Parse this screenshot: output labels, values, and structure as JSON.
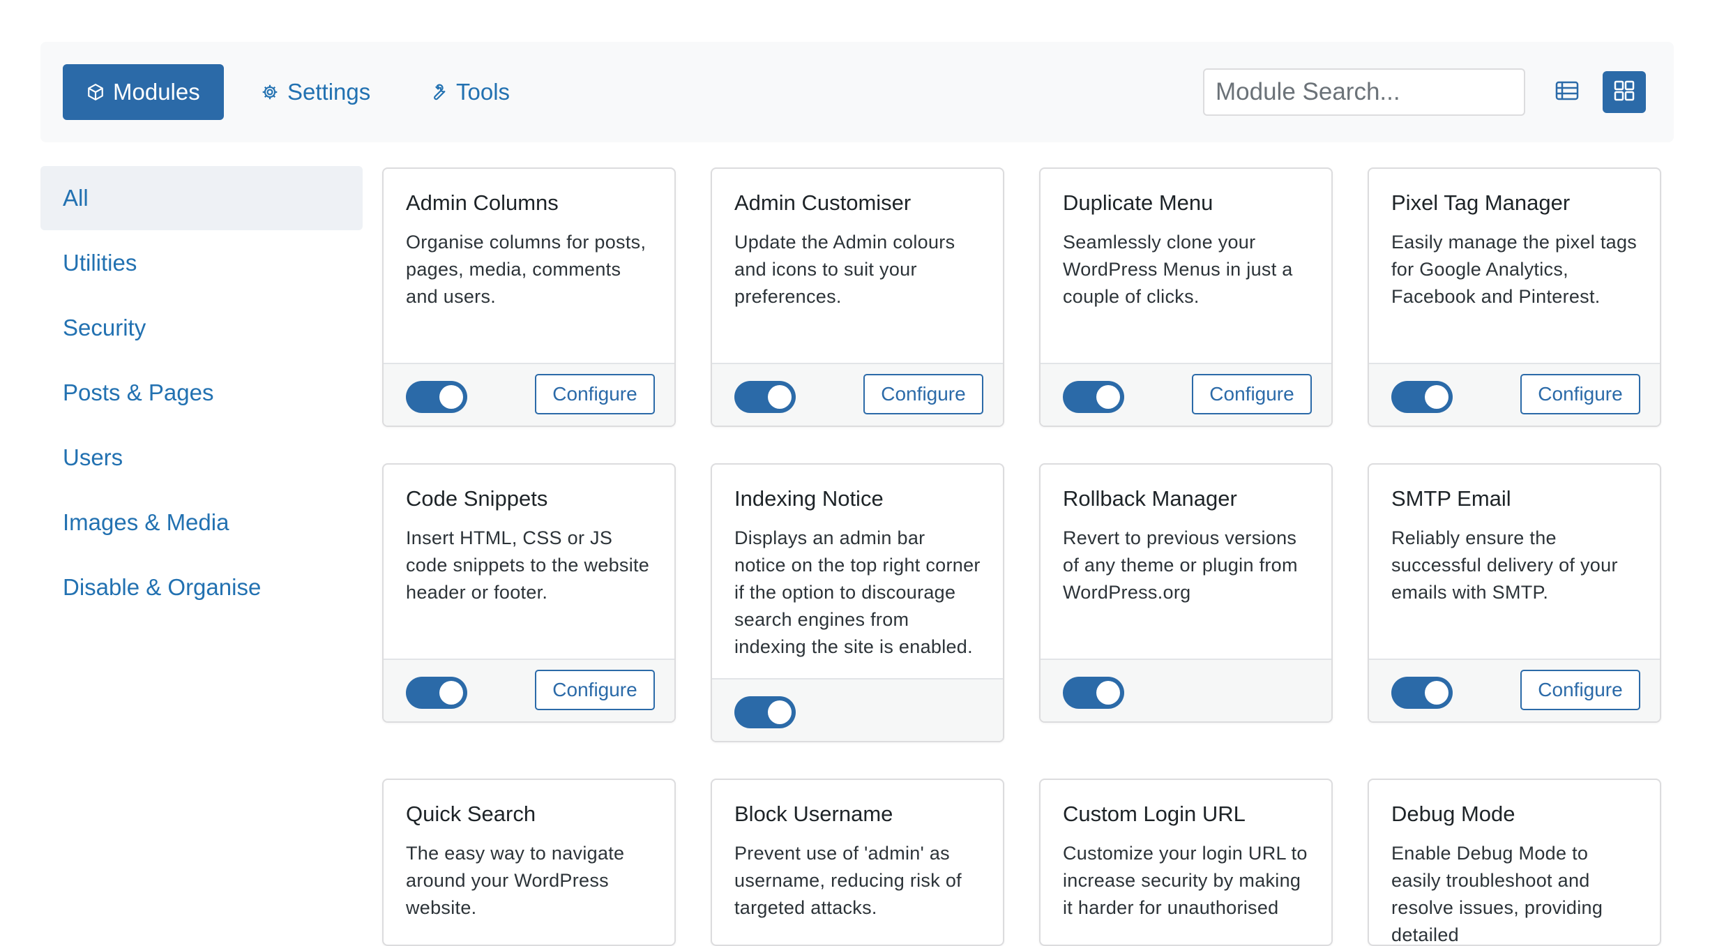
{
  "tabs": [
    {
      "label": "Modules",
      "icon": "cube-icon"
    },
    {
      "label": "Settings",
      "icon": "gear-icon"
    },
    {
      "label": "Tools",
      "icon": "wrench-icon"
    }
  ],
  "search": {
    "placeholder": "Module Search..."
  },
  "colors": {
    "accent": "#2b6aa8",
    "link": "#2271b1"
  },
  "sidebar": {
    "items": [
      "All",
      "Utilities",
      "Security",
      "Posts & Pages",
      "Users",
      "Images & Media",
      "Disable & Organise"
    ]
  },
  "modules": [
    {
      "title": "Admin Columns",
      "desc": "Organise columns for posts, pages, media, comments and users.",
      "enabled": true,
      "configure": "Configure"
    },
    {
      "title": "Admin Customiser",
      "desc": "Update the Admin colours and icons to suit your preferences.",
      "enabled": true,
      "configure": "Configure"
    },
    {
      "title": "Duplicate Menu",
      "desc": "Seamlessly clone your WordPress Menus in just a couple of clicks.",
      "enabled": true,
      "configure": "Configure"
    },
    {
      "title": "Pixel Tag Manager",
      "desc": "Easily manage the pixel tags for Google Analytics, Facebook and Pinterest.",
      "enabled": true,
      "configure": "Configure"
    },
    {
      "title": "Code Snippets",
      "desc": "Insert HTML, CSS or JS code snippets to the website header or footer.",
      "enabled": true,
      "configure": "Configure"
    },
    {
      "title": "Indexing Notice",
      "desc": "Displays an admin bar notice on the top right corner if the option to discourage search engines from indexing the site is enabled.",
      "enabled": true
    },
    {
      "title": "Rollback Manager",
      "desc": "Revert to previous versions of any theme or plugin from WordPress.org",
      "enabled": true
    },
    {
      "title": "SMTP Email",
      "desc": "Reliably ensure the successful delivery of your emails with SMTP.",
      "enabled": true,
      "configure": "Configure"
    },
    {
      "title": "Quick Search",
      "desc": "The easy way to navigate around your WordPress website."
    },
    {
      "title": "Block Username",
      "desc": "Prevent use of 'admin' as username, reducing risk of targeted attacks."
    },
    {
      "title": "Custom Login URL",
      "desc": "Customize your login URL to increase security by making it harder for unauthorised"
    },
    {
      "title": "Debug Mode",
      "desc": "Enable Debug Mode to easily troubleshoot and resolve issues, providing detailed"
    }
  ]
}
